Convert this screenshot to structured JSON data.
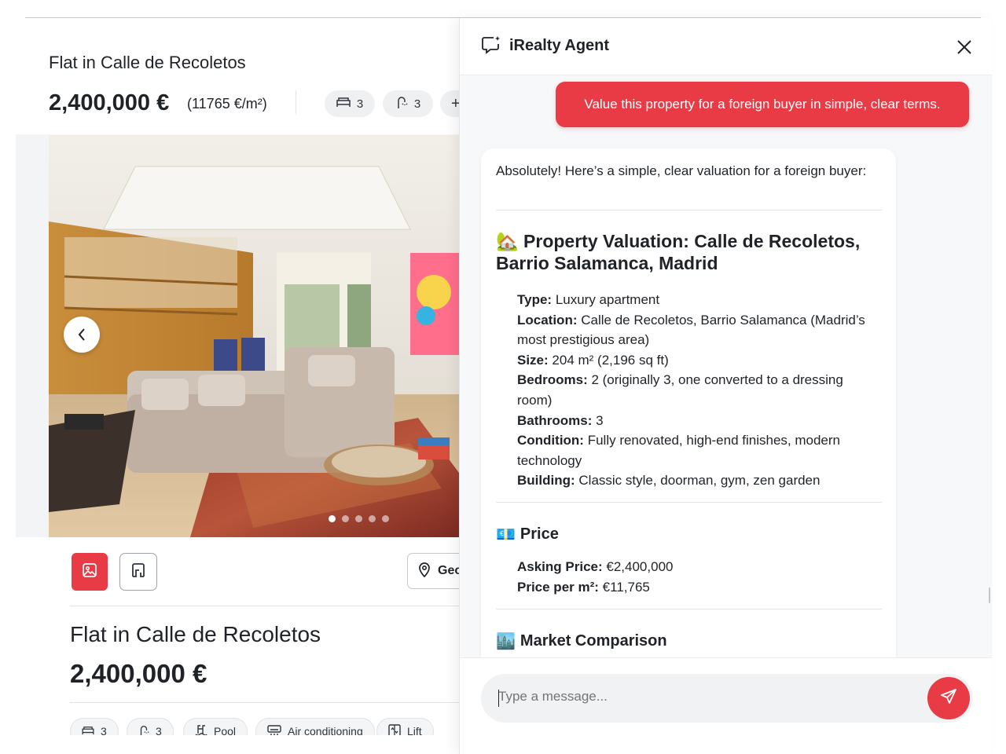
{
  "listing": {
    "title": "Flat in Calle de Recoletos",
    "price": "2,400,000 €",
    "price_per_m2": "(11765 €/m²)",
    "chips": [
      {
        "icon": "bed-icon",
        "value": "3"
      },
      {
        "icon": "bath-icon",
        "value": "3"
      },
      {
        "icon": "plus-icon",
        "value": "+"
      }
    ],
    "photo": {
      "dots_total": 5,
      "active_dot": 0
    },
    "geo_button_label": "Geo",
    "detail_title": "Flat in Calle de Recoletos",
    "detail_price": "2,400,000 €",
    "features": [
      {
        "icon": "bed-icon",
        "label": "3"
      },
      {
        "icon": "bath-icon",
        "label": "3"
      },
      {
        "icon": "pool-icon",
        "label": "Pool"
      },
      {
        "icon": "air-conditioning-icon",
        "label": "Air conditioning"
      },
      {
        "icon": "lift-icon",
        "label": "Lift"
      }
    ]
  },
  "agent": {
    "title": "iRealty Agent",
    "user_message": "Value this property for a foreign buyer in simple, clear terms.",
    "reply": {
      "intro": "Absolutely! Here’s a simple, clear valuation for a foreign buyer:",
      "heading_emoji": "🏡",
      "heading": "Property Valuation: Calle de Recoletos, Barrio Salamanca, Madrid",
      "details": [
        {
          "label": "Type:",
          "value": "Luxury apartment"
        },
        {
          "label": "Location:",
          "value": "Calle de Recoletos, Barrio Salamanca (Madrid’s most prestigious area)"
        },
        {
          "label": "Size:",
          "value": "204 m² (2,196 sq ft)"
        },
        {
          "label": "Bedrooms:",
          "value": "2 (originally 3, one converted to a dressing room)"
        },
        {
          "label": "Bathrooms:",
          "value": "3"
        },
        {
          "label": "Condition:",
          "value": "Fully renovated, high-end finishes, modern technology"
        },
        {
          "label": "Building:",
          "value": "Classic style, doorman, gym, zen garden"
        }
      ],
      "price_emoji": "💶",
      "price_heading": "Price",
      "price_items": [
        {
          "label": "Asking Price:",
          "value": "€2,400,000"
        },
        {
          "label": "Price per m²:",
          "value": "€11,765"
        }
      ],
      "market_emoji": "🏙️",
      "market_heading": "Market Comparison"
    },
    "composer": {
      "placeholder": "Type a message..."
    }
  },
  "colors": {
    "accent": "#e83b46",
    "text": "#1f2328",
    "panel_bg": "#f7f8fa"
  }
}
